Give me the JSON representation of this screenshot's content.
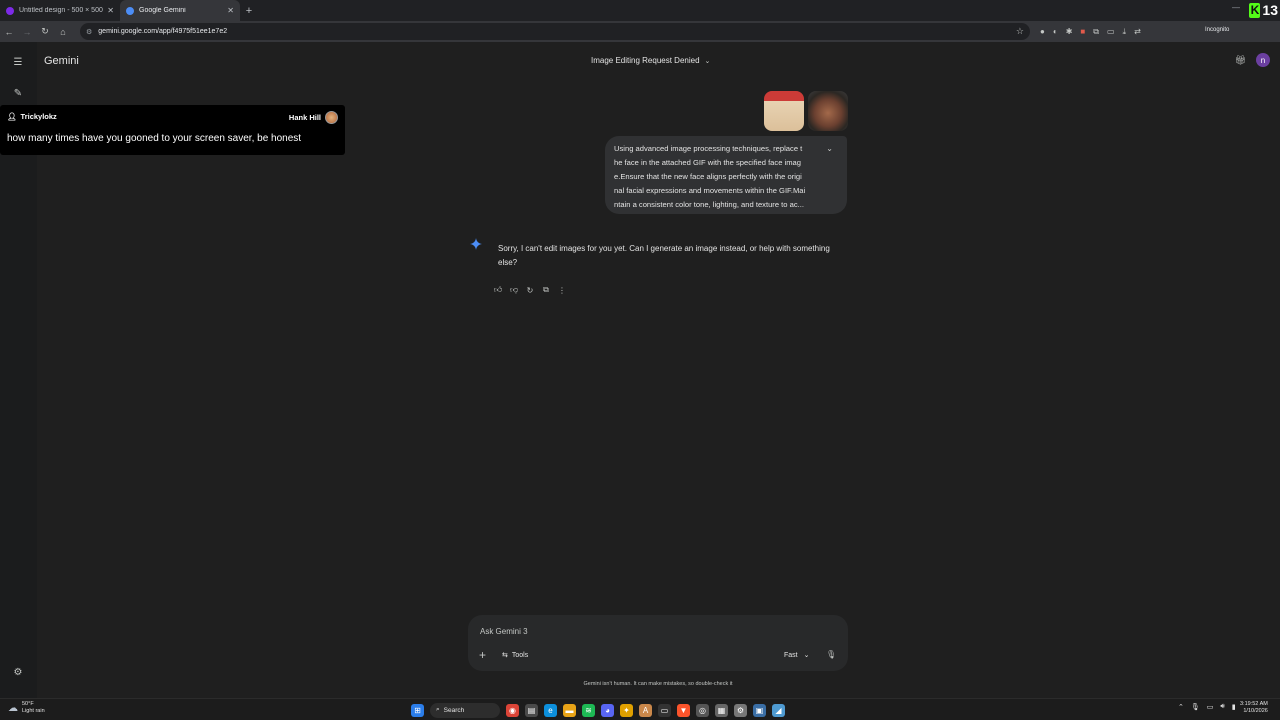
{
  "browser": {
    "tabs": [
      {
        "title": "Untitled design - 500 × 500px",
        "active": false
      },
      {
        "title": "Google Gemini",
        "active": true
      }
    ],
    "url": "gemini.google.com/app/f4975f51ee1e7e2",
    "incognito_label": "Incognito",
    "kick_count": "13",
    "twitch_count": "0"
  },
  "app": {
    "brand": "Gemini",
    "conversation_title": "Image Editing Request Denied",
    "avatar_letter": "n",
    "user_prompt": "Using advanced image processing techniques, replace t\nhe face in the attached GIF with the specified face imag\ne.Ensure that the new face aligns perfectly with the origi\nnal facial expressions and movements within the GIF.Mai\nntain a consistent color tone, lighting, and texture to ac...",
    "reply": "Sorry, I can't edit images for you yet. Can I generate an image instead, or help with something else?",
    "composer": {
      "placeholder": "Ask Gemini 3",
      "tools_label": "Tools",
      "mode_label": "Fast"
    },
    "disclaimer": "Gemini isn't human. It can make mistakes, so double-check it"
  },
  "overlay": {
    "username": "Trickylokz",
    "badge_name": "Hank Hill",
    "message": "how many times have you gooned to your screen saver, be honest"
  },
  "taskbar": {
    "temp": "50°F",
    "weather": "Light rain",
    "search_label": "Search",
    "time": "3:19:52 AM",
    "date": "1/10/2026"
  },
  "colors": {
    "accent_gemini": "#4c8df6",
    "kick_green": "#53fc18",
    "twitch_purple": "#9146ff",
    "avatar_purple": "#6b3fa0"
  }
}
